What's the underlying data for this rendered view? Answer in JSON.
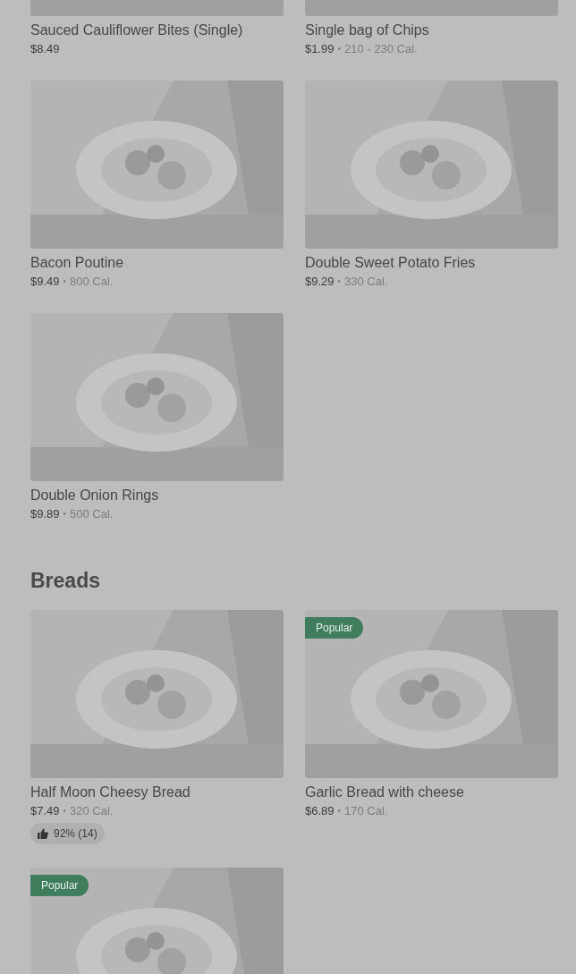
{
  "separator": "•",
  "sections": [
    {
      "items": [
        {
          "name": "Sauced Cauliflower Bites (Single)",
          "price": "$8.49"
        },
        {
          "name": "Single bag of Chips",
          "price": "$1.99",
          "calories": "210 - 230 Cal."
        },
        {
          "name": "Bacon Poutine",
          "price": "$9.49",
          "calories": "800 Cal."
        },
        {
          "name": "Double Sweet Potato Fries",
          "price": "$9.29",
          "calories": "330 Cal."
        },
        {
          "name": "Double Onion Rings",
          "price": "$9.89",
          "calories": "500 Cal."
        }
      ]
    },
    {
      "title": "Breads",
      "items": [
        {
          "name": "Half Moon Cheesy Bread",
          "price": "$7.49",
          "calories": "320 Cal.",
          "rating": "92% (14)"
        },
        {
          "badge": "Popular",
          "name": "Garlic Bread with cheese",
          "price": "$6.89",
          "calories": "170 Cal."
        },
        {
          "badge": "Popular"
        }
      ]
    }
  ]
}
